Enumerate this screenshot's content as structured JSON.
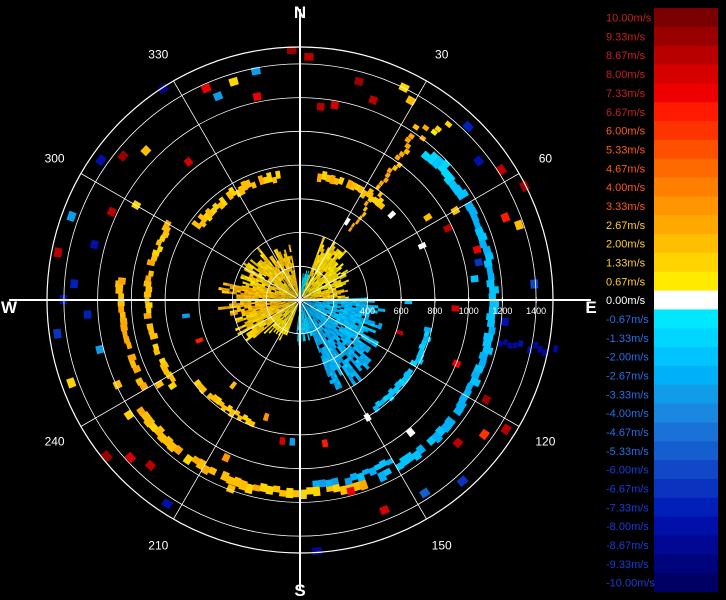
{
  "chart_data": {
    "type": "polar-radar",
    "cardinals": {
      "north": "N",
      "east": "E",
      "south": "S",
      "west": "W"
    },
    "azimuth_labels": [
      {
        "deg": 30,
        "text": "30"
      },
      {
        "deg": 60,
        "text": "60"
      },
      {
        "deg": 120,
        "text": "120"
      },
      {
        "deg": 150,
        "text": "150"
      },
      {
        "deg": 210,
        "text": "210"
      },
      {
        "deg": 240,
        "text": "240"
      },
      {
        "deg": 300,
        "text": "300"
      },
      {
        "deg": 330,
        "text": "330"
      }
    ],
    "range_rings": [
      200,
      400,
      600,
      800,
      1000,
      1200,
      1400
    ],
    "range_labels": [
      "400",
      "600",
      "800",
      "1000",
      "1200",
      "1400"
    ],
    "max_range": 1500,
    "colorbar": {
      "labels": [
        "10.00m/s",
        "9.33m/s",
        "8.67m/s",
        "8.00m/s",
        "7.33m/s",
        "6.67m/s",
        "6.00m/s",
        "5.33m/s",
        "4.67m/s",
        "4.00m/s",
        "3.33m/s",
        "2.67m/s",
        "2.00m/s",
        "1.33m/s",
        "0.67m/s",
        "0.00m/s",
        "-0.67m/s",
        "-1.33m/s",
        "-2.00m/s",
        "-2.67m/s",
        "-3.33m/s",
        "-4.00m/s",
        "-4.67m/s",
        "-5.33m/s",
        "-6.00m/s",
        "-6.67m/s",
        "-7.33m/s",
        "-8.00m/s",
        "-8.67m/s",
        "-9.33m/s",
        "-10.00m/s"
      ],
      "colors": [
        "#7a0000",
        "#990000",
        "#b80000",
        "#d60000",
        "#ee0000",
        "#ff1a00",
        "#ff3300",
        "#ff5000",
        "#ff6a00",
        "#ff8000",
        "#ff9500",
        "#ffa800",
        "#ffbf00",
        "#ffd400",
        "#ffea00",
        "#ffffff",
        "#00e8ff",
        "#00d6ff",
        "#00c3ff",
        "#00b0f8",
        "#109ce8",
        "#1a88e0",
        "#1a72d8",
        "#155ed0",
        "#1048c8",
        "#0a34c0",
        "#0020b8",
        "#0010a8",
        "#000894",
        "#00047c",
        "#000064"
      ],
      "label_colors": {
        "positive": "#cc1a1a",
        "zero": "#ffffff",
        "negative": "#2a6ee8"
      }
    },
    "velocity_field": [
      {
        "az_from": 282,
        "az_to": 322,
        "r_from": 25,
        "r_to": 360,
        "v": 1.4
      },
      {
        "az_from": 322,
        "az_to": 350,
        "r_from": 25,
        "r_to": 300,
        "v": 1.8
      },
      {
        "az_from": 255,
        "az_to": 282,
        "r_from": 25,
        "r_to": 420,
        "v": 2.2
      },
      {
        "az_from": 230,
        "az_to": 255,
        "r_from": 25,
        "r_to": 380,
        "v": 1.5
      },
      {
        "az_from": 200,
        "az_to": 230,
        "r_from": 25,
        "r_to": 250,
        "v": 1.0
      },
      {
        "az_from": 20,
        "az_to": 45,
        "r_from": 25,
        "r_to": 380,
        "v": 1.2
      },
      {
        "az_from": 45,
        "az_to": 70,
        "r_from": 25,
        "r_to": 300,
        "v": 0.9
      },
      {
        "az_from": 70,
        "az_to": 88,
        "r_from": 25,
        "r_to": 260,
        "v": 1.5
      },
      {
        "az_from": 88,
        "az_to": 128,
        "r_from": 25,
        "r_to": 470,
        "v": -2.3
      },
      {
        "az_from": 128,
        "az_to": 160,
        "r_from": 25,
        "r_to": 520,
        "v": -2.7
      },
      {
        "az_from": 160,
        "az_to": 186,
        "r_from": 25,
        "r_to": 220,
        "v": -1.7
      },
      {
        "az_from": 6,
        "az_to": 20,
        "r_from": 25,
        "r_to": 160,
        "v": -1.2
      }
    ],
    "rings": [
      {
        "az_from": 305,
        "az_to": 350,
        "r_from": 720,
        "r_to": 770,
        "v": 1.8
      },
      {
        "az_from": 8,
        "az_to": 42,
        "r_from": 720,
        "r_to": 770,
        "v": 2.0
      },
      {
        "az_from": 235,
        "az_to": 300,
        "r_from": 880,
        "r_to": 920,
        "v": 1.9
      },
      {
        "az_from": 240,
        "az_to": 275,
        "r_from": 1040,
        "r_to": 1080,
        "v": 2.3
      },
      {
        "az_from": 160,
        "az_to": 235,
        "r_from": 1120,
        "r_to": 1170,
        "v": 1.9
      },
      {
        "az_from": 200,
        "az_to": 232,
        "r_from": 760,
        "r_to": 800,
        "v": 1.6
      },
      {
        "az_from": 40,
        "az_to": 62,
        "r_from": 1120,
        "r_to": 1180,
        "v": -1.8
      },
      {
        "az_from": 62,
        "az_to": 155,
        "r_from": 1120,
        "r_to": 1170,
        "v": -2.4
      },
      {
        "az_from": 100,
        "az_to": 145,
        "r_from": 760,
        "r_to": 800,
        "v": -2.0
      },
      {
        "az_from": 150,
        "az_to": 175,
        "r_from": 1080,
        "r_to": 1120,
        "v": -2.6
      }
    ],
    "spokes": [
      {
        "az_from": 33,
        "az_to": 38,
        "r_from": 500,
        "r_to": 1260,
        "v": 2.3
      },
      {
        "az_from": 37,
        "az_to": 41,
        "r_from": 1260,
        "r_to": 1360,
        "v": 1.2
      },
      {
        "az_from": 100,
        "az_to": 103,
        "r_from": 1200,
        "r_to": 1560,
        "v": -8.6
      }
    ],
    "echo_blocks": [
      {
        "az": 358,
        "r": 1460,
        "v": 9.3
      },
      {
        "az": 2,
        "r": 1420,
        "v": 9.0
      },
      {
        "az": 349,
        "r": 1360,
        "v": -3.3
      },
      {
        "az": 327,
        "r": 1470,
        "v": -9.3
      },
      {
        "az": 15,
        "r": 1320,
        "v": 9.3
      },
      {
        "az": 20,
        "r": 1240,
        "v": 8.7
      },
      {
        "az": 26,
        "r": 1380,
        "v": 1.3
      },
      {
        "az": 29,
        "r": 1330,
        "v": 1.8
      },
      {
        "az": 44,
        "r": 1410,
        "v": -7.3
      },
      {
        "az": 52,
        "r": 1320,
        "v": -8.0
      },
      {
        "az": 57,
        "r": 1400,
        "v": 8.7
      },
      {
        "az": 63,
        "r": 1470,
        "v": 9.3
      },
      {
        "az": 68,
        "r": 1290,
        "v": 6.7
      },
      {
        "az": 71,
        "r": 1350,
        "v": 2.3
      },
      {
        "az": 74,
        "r": 1070,
        "v": 7.3
      },
      {
        "az": 78,
        "r": 1060,
        "v": -6.7
      },
      {
        "az": 83,
        "r": 1020,
        "v": -2.3
      },
      {
        "az": 91,
        "r": 620,
        "v": -2.0
      },
      {
        "az": 93,
        "r": 900,
        "v": 8.0
      },
      {
        "az": 108,
        "r": 600,
        "v": 8.7
      },
      {
        "az": 112,
        "r": 980,
        "v": 7.3
      },
      {
        "az": 118,
        "r": 1230,
        "v": 9.3
      },
      {
        "az": 122,
        "r": 1420,
        "v": 8.7
      },
      {
        "az": 126,
        "r": 1330,
        "v": 6.0
      },
      {
        "az": 132,
        "r": 1240,
        "v": 8.7
      },
      {
        "az": 138,
        "r": 1420,
        "v": -6.7
      },
      {
        "az": 147,
        "r": 1340,
        "v": -5.3
      },
      {
        "az": 158,
        "r": 1320,
        "v": 8.0
      },
      {
        "az": 165,
        "r": 1150,
        "v": 7.3
      },
      {
        "az": 170,
        "r": 840,
        "v": 6.7
      },
      {
        "az": 176,
        "r": 1470,
        "v": -8.7
      },
      {
        "az": 183,
        "r": 820,
        "v": -3.3
      },
      {
        "az": 187,
        "r": 820,
        "v": 8.0
      },
      {
        "az": 200,
        "r": 1170,
        "v": 2.3
      },
      {
        "az": 205,
        "r": 1010,
        "v": 3.3
      },
      {
        "az": 213,
        "r": 1420,
        "v": -8.0
      },
      {
        "az": 222,
        "r": 1300,
        "v": 8.7
      },
      {
        "az": 227,
        "r": 1350,
        "v": 8.0
      },
      {
        "az": 231,
        "r": 1450,
        "v": 9.3
      },
      {
        "az": 236,
        "r": 1200,
        "v": 1.5
      },
      {
        "az": 239,
        "r": 950,
        "v": 2.3
      },
      {
        "az": 245,
        "r": 1170,
        "v": 2.0
      },
      {
        "az": 250,
        "r": 1420,
        "v": 1.6
      },
      {
        "az": 256,
        "r": 1200,
        "v": -3.3
      },
      {
        "az": 262,
        "r": 1430,
        "v": -6.7
      },
      {
        "az": 266,
        "r": 1240,
        "v": -7.3
      },
      {
        "az": 270,
        "r": 1380,
        "v": -8.0
      },
      {
        "az": 274,
        "r": 1320,
        "v": -7.3
      },
      {
        "az": 276,
        "r": 1040,
        "v": 2.5
      },
      {
        "az": 281,
        "r": 1440,
        "v": 8.7
      },
      {
        "az": 285,
        "r": 1240,
        "v": -8.0
      },
      {
        "az": 290,
        "r": 1420,
        "v": -3.3
      },
      {
        "az": 295,
        "r": 1210,
        "v": 8.7
      },
      {
        "az": 300,
        "r": 1100,
        "v": 1.2
      },
      {
        "az": 305,
        "r": 1420,
        "v": -8.0
      },
      {
        "az": 309,
        "r": 1330,
        "v": 9.3
      },
      {
        "az": 314,
        "r": 1250,
        "v": 2.0
      },
      {
        "az": 321,
        "r": 1030,
        "v": 8.0
      },
      {
        "az": 336,
        "r": 1350,
        "v": 7.3
      },
      {
        "az": 338,
        "r": 1280,
        "v": -3.3
      },
      {
        "az": 343,
        "r": 1330,
        "v": 1.4
      },
      {
        "az": 348,
        "r": 1210,
        "v": 7.3
      },
      {
        "az": 6,
        "r": 1130,
        "v": 8.7
      },
      {
        "az": 10,
        "r": 1150,
        "v": 8.0
      },
      {
        "az": 60,
        "r": 1040,
        "v": 2.3
      },
      {
        "az": 64,
        "r": 950,
        "v": 8.7
      },
      {
        "az": 86,
        "r": 1370,
        "v": -6.0
      },
      {
        "az": 96,
        "r": 1200,
        "v": -8.0
      },
      {
        "az": 140,
        "r": 1000,
        "v": 0.0
      },
      {
        "az": 150,
        "r": 780,
        "v": 0.0
      },
      {
        "az": 196,
        "r": 700,
        "v": 3.3
      },
      {
        "az": 218,
        "r": 620,
        "v": 1.8
      },
      {
        "az": 248,
        "r": 620,
        "v": 6.7
      },
      {
        "az": 262,
        "r": 660,
        "v": -3.3
      },
      {
        "az": 47,
        "r": 720,
        "v": 0.0
      },
      {
        "az": 31,
        "r": 520,
        "v": 0.0
      },
      {
        "az": 57,
        "r": 880,
        "v": 2.0
      },
      {
        "az": 66,
        "r": 770,
        "v": 0.0
      }
    ]
  }
}
